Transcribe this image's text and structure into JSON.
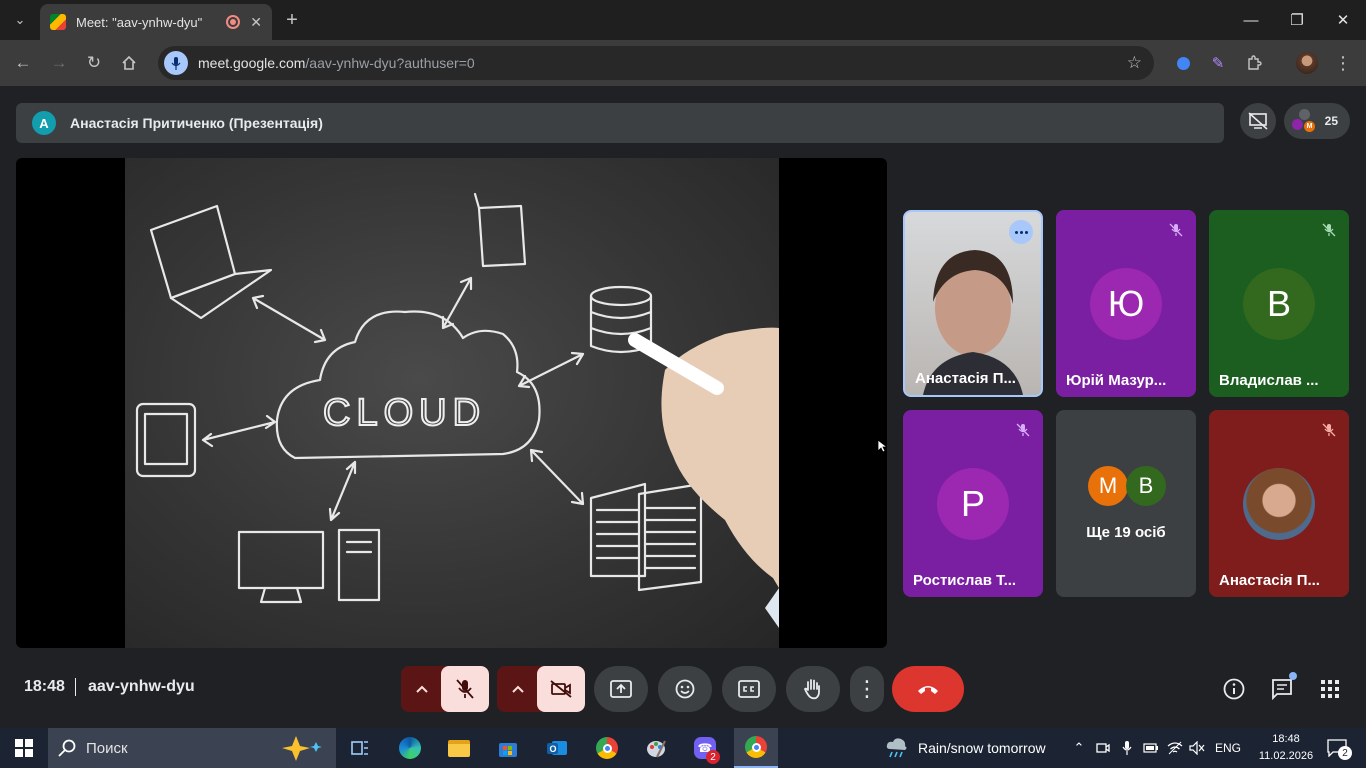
{
  "browser": {
    "tab_title": "Meet: \"aav-ynhw-dyu\"",
    "url_host": "meet.google.com",
    "url_path": "/aav-ynhw-dyu?authuser=0"
  },
  "meet": {
    "presenter_initial": "A",
    "presenter_label": "Анастасія Притиченко (Презентація)",
    "participant_count": "25",
    "slide_text": "CLOUD",
    "tiles": [
      {
        "name": "Анастасія П...",
        "initial": "",
        "color": "#3c4043"
      },
      {
        "name": "Юрій Мазур...",
        "initial": "Ю",
        "color": "#8e24aa"
      },
      {
        "name": "Владислав ...",
        "initial": "В",
        "color": "#33691e"
      },
      {
        "name": "Ростислав Т...",
        "initial": "Р",
        "color": "#8e24aa"
      },
      {
        "name": "Ще 19 осіб",
        "initial": "",
        "color": "#3c4043"
      },
      {
        "name": "Анастасія П...",
        "initial": "",
        "color": "#8b1c1c"
      }
    ],
    "others_avatars": [
      "М",
      "В"
    ],
    "clock": "18:48",
    "meeting_code": "aav-ynhw-dyu"
  },
  "taskbar": {
    "search_placeholder": "Поиск",
    "weather": "Rain/snow tomorrow",
    "lang": "ENG",
    "time": "18:48",
    "date": "11.02.2026",
    "notifications": "2",
    "viber_badge": "2"
  }
}
